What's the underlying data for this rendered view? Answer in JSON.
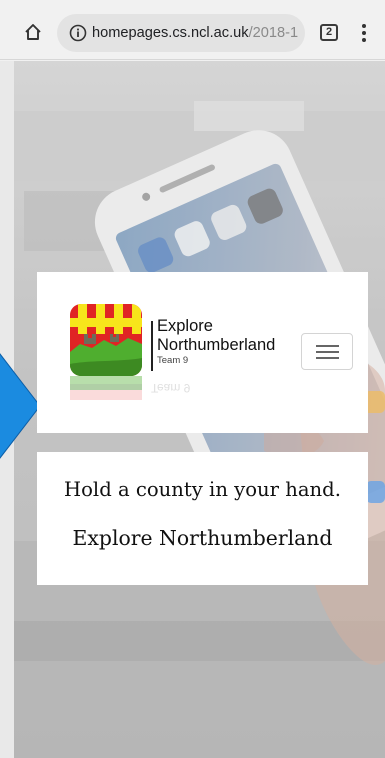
{
  "browser": {
    "url_domain": "homepages.cs.ncl.ac.uk",
    "url_path": "/2018-1",
    "tab_count": "2"
  },
  "header": {
    "brand_line1": "Explore",
    "brand_line2": "Northumberland",
    "brand_subtitle": "Team 9",
    "reflection_text": "Team 9"
  },
  "tagline": {
    "line1": "Hold a county in your hand.",
    "line2": "Explore Northumberland"
  },
  "colors": {
    "arrow_blue": "#1b8be0",
    "logo_red": "#e02424",
    "logo_yellow": "#f7e51b",
    "logo_green": "#4fae2f"
  },
  "icons": [
    "home-icon",
    "info-icon",
    "tab-switcher-icon",
    "overflow-menu-icon",
    "hamburger-menu-icon",
    "left-arrow-icon"
  ]
}
